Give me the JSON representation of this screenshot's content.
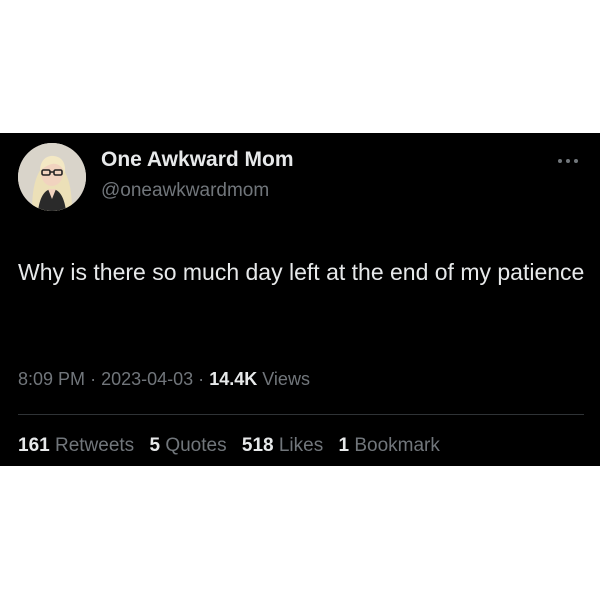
{
  "tweet": {
    "display_name": "One Awkward Mom",
    "handle": "@oneawkwardmom",
    "text": "Why is there so much day left at the end of my patience",
    "time": "8:09 PM",
    "separator": "·",
    "date": "2023-04-03",
    "views_count": "14.4K",
    "views_label": "Views",
    "more_icon": "more-horizontal-icon",
    "avatar_icon": "profile-photo"
  },
  "stats": {
    "retweets_count": "161",
    "retweets_label": "Retweets",
    "quotes_count": "5",
    "quotes_label": "Quotes",
    "likes_count": "518",
    "likes_label": "Likes",
    "bookmarks_count": "1",
    "bookmarks_label": "Bookmark"
  },
  "colors": {
    "card_background": "#000000",
    "page_background": "#ffffff",
    "primary_text": "#e7e9ea",
    "secondary_text": "#71767b",
    "divider": "#2f3336"
  }
}
